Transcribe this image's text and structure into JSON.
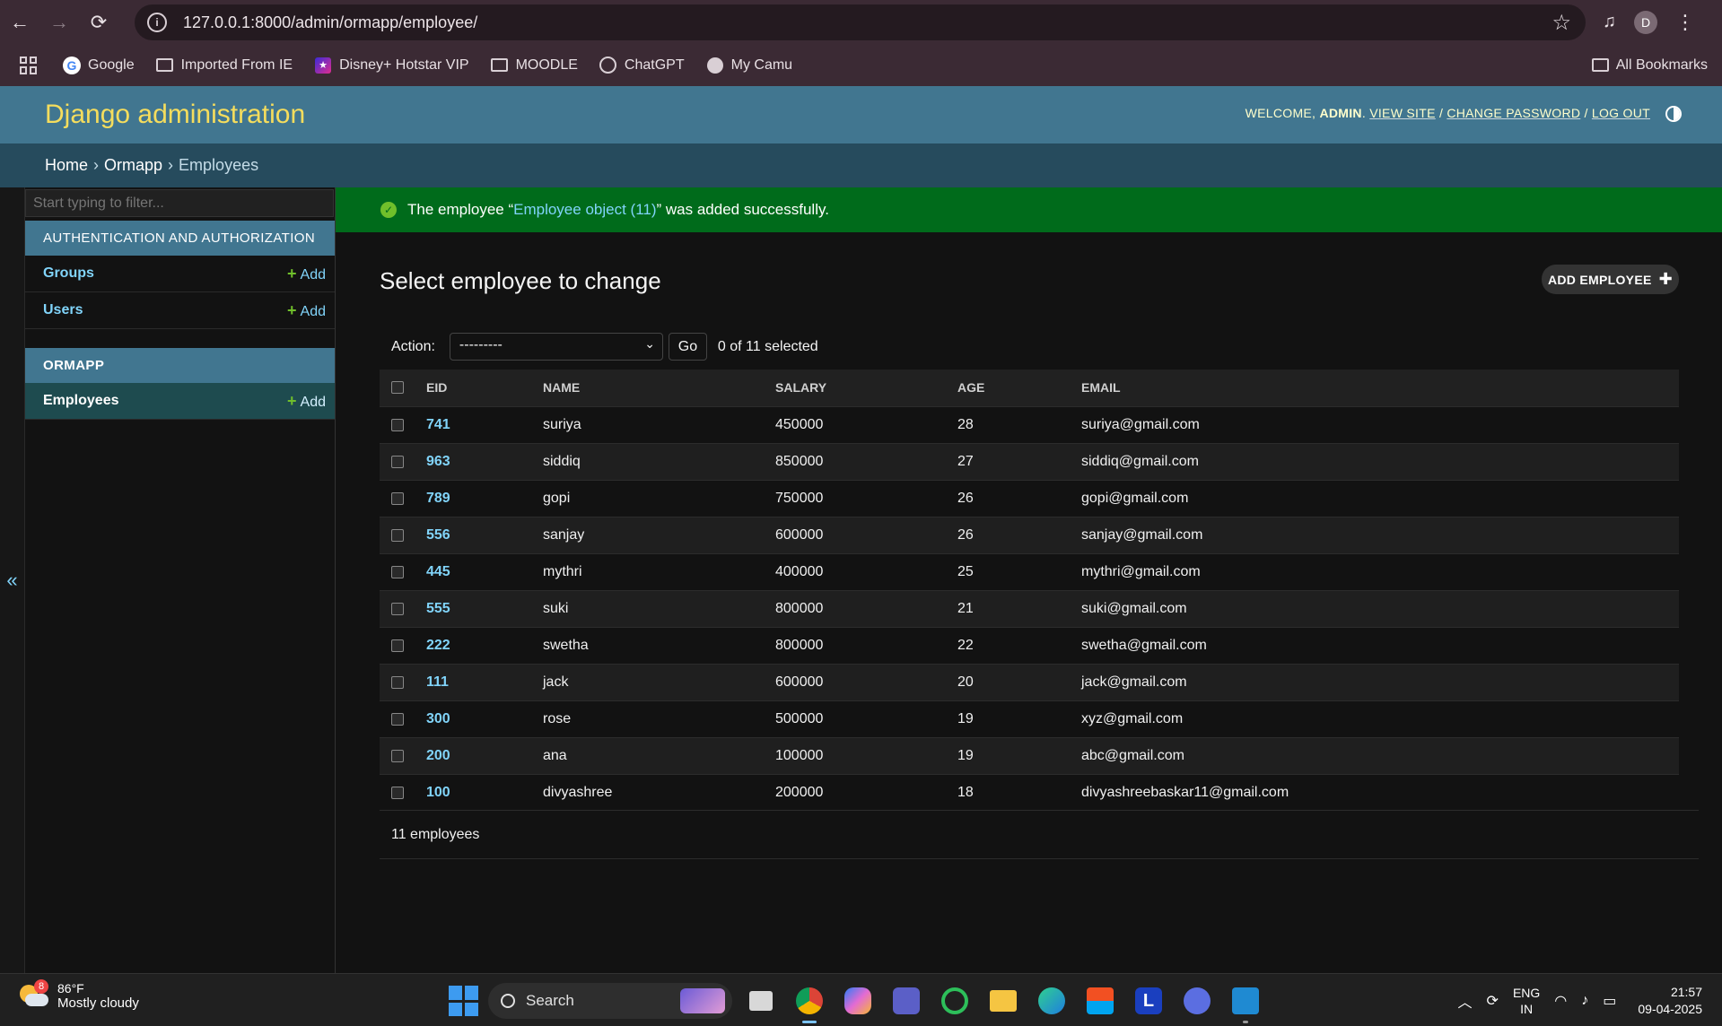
{
  "browser": {
    "url": "127.0.0.1:8000/admin/ormapp/employee/",
    "profile_initial": "D",
    "bookmarks": [
      {
        "label": "Google",
        "icon": "google-icon"
      },
      {
        "label": "Imported From IE",
        "icon": "folder-icon"
      },
      {
        "label": "Disney+ Hotstar VIP",
        "icon": "hotstar-icon"
      },
      {
        "label": "MOODLE",
        "icon": "folder-icon"
      },
      {
        "label": "ChatGPT",
        "icon": "chatgpt-icon"
      },
      {
        "label": "My Camu",
        "icon": "globe-icon"
      }
    ],
    "all_bookmarks": "All Bookmarks"
  },
  "header": {
    "branding": "Django administration",
    "welcome": "Welcome,",
    "user": "admin",
    "view_site": "View site",
    "change_password": "Change password",
    "log_out": "Log out",
    "sep": "/"
  },
  "breadcrumbs": {
    "home": "Home",
    "app": "Ormapp",
    "current": "Employees",
    "sep": "›"
  },
  "sidebar": {
    "filter_placeholder": "Start typing to filter...",
    "modules": [
      {
        "caption": "Authentication and Authorization",
        "models": [
          {
            "name": "Groups",
            "add": "Add"
          },
          {
            "name": "Users",
            "add": "Add"
          }
        ]
      },
      {
        "caption": "Ormapp",
        "models": [
          {
            "name": "Employees",
            "add": "Add"
          }
        ]
      }
    ],
    "collapse_glyph": "«"
  },
  "message": {
    "prefix": "The employee “",
    "object": "Employee object (11)",
    "suffix": "” was added successfully."
  },
  "main": {
    "title": "Select employee to change",
    "add_button": "Add Employee",
    "action_label": "Action:",
    "action_selected": "---------",
    "go_label": "Go",
    "selected_count": "0 of 11 selected",
    "columns": [
      "EID",
      "Name",
      "Salary",
      "Age",
      "Email"
    ],
    "rows": [
      {
        "eid": "741",
        "name": "suriya",
        "salary": "450000",
        "age": "28",
        "email": "suriya@gmail.com"
      },
      {
        "eid": "963",
        "name": "siddiq",
        "salary": "850000",
        "age": "27",
        "email": "siddiq@gmail.com"
      },
      {
        "eid": "789",
        "name": "gopi",
        "salary": "750000",
        "age": "26",
        "email": "gopi@gmail.com"
      },
      {
        "eid": "556",
        "name": "sanjay",
        "salary": "600000",
        "age": "26",
        "email": "sanjay@gmail.com"
      },
      {
        "eid": "445",
        "name": "mythri",
        "salary": "400000",
        "age": "25",
        "email": "mythri@gmail.com"
      },
      {
        "eid": "555",
        "name": "suki",
        "salary": "800000",
        "age": "21",
        "email": "suki@gmail.com"
      },
      {
        "eid": "222",
        "name": "swetha",
        "salary": "800000",
        "age": "22",
        "email": "swetha@gmail.com"
      },
      {
        "eid": "111",
        "name": "jack",
        "salary": "600000",
        "age": "20",
        "email": "jack@gmail.com"
      },
      {
        "eid": "300",
        "name": "rose",
        "salary": "500000",
        "age": "19",
        "email": "xyz@gmail.com"
      },
      {
        "eid": "200",
        "name": "ana",
        "salary": "100000",
        "age": "19",
        "email": "abc@gmail.com"
      },
      {
        "eid": "100",
        "name": "divyashree",
        "salary": "200000",
        "age": "18",
        "email": "divyashreebaskar11@gmail.com"
      }
    ],
    "paginator": "11 employees"
  },
  "taskbar": {
    "weather_temp": "86°F",
    "weather_desc": "Mostly cloudy",
    "weather_badge": "8",
    "search_label": "Search",
    "lang_line1": "ENG",
    "lang_line2": "IN",
    "time": "21:57",
    "date": "09-04-2025"
  },
  "colors": {
    "header_bg": "#417690",
    "breadcrumb_bg": "#264b5d",
    "success_bg": "#006b1b",
    "link": "#81d4fa",
    "branding": "#f5dd5d",
    "add_plus": "#70bf2b"
  }
}
